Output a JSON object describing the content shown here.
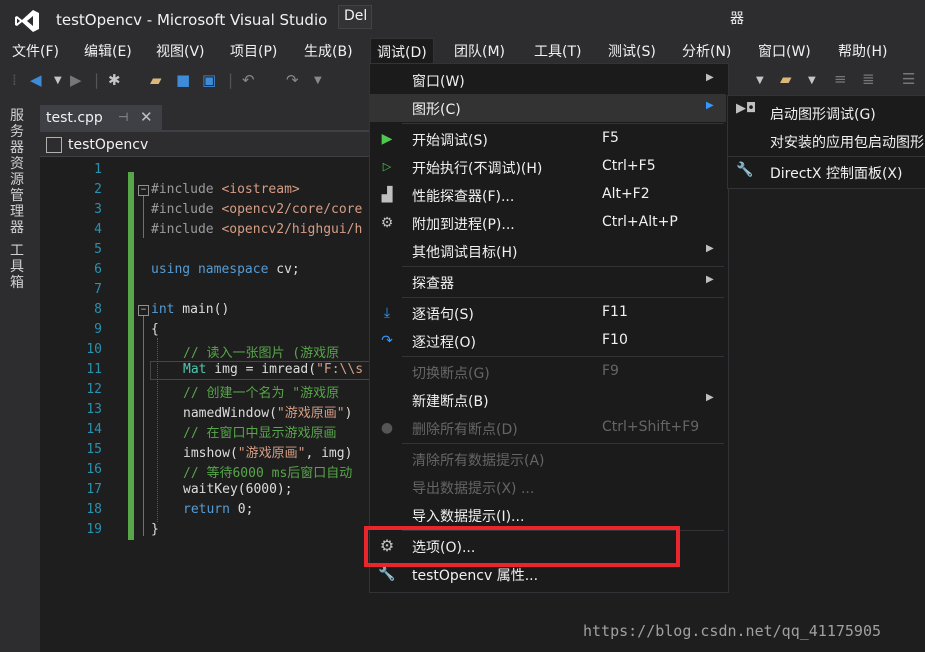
{
  "window": {
    "title": "testOpencv - Microsoft Visual Studio"
  },
  "menubar": [
    {
      "label": "文件(F)"
    },
    {
      "label": "编辑(E)"
    },
    {
      "label": "视图(V)"
    },
    {
      "label": "项目(P)"
    },
    {
      "label": "生成(B)"
    },
    {
      "label": "调试(D)"
    },
    {
      "label": "团队(M)"
    },
    {
      "label": "工具(T)"
    },
    {
      "label": "测试(S)"
    },
    {
      "label": "分析(N)"
    },
    {
      "label": "窗口(W)"
    },
    {
      "label": "帮助(H)"
    }
  ],
  "toolbar": {
    "config_text": "Del",
    "right_text": "器"
  },
  "sidebar": {
    "server_explorer": "服务器资源管理器",
    "toolbox": "工具箱"
  },
  "tab": {
    "name": "test.cpp"
  },
  "navbar": {
    "project": "testOpencv"
  },
  "editor": {
    "line_numbers": [
      "1",
      "2",
      "3",
      "4",
      "5",
      "6",
      "7",
      "8",
      "9",
      "10",
      "11",
      "12",
      "13",
      "14",
      "15",
      "16",
      "17",
      "18",
      "19"
    ],
    "lines": {
      "l2a": "#include ",
      "l2b": "<iostream>",
      "l3a": "#include ",
      "l3b": "<opencv2/core/core",
      "l4a": "#include ",
      "l4b": "<opencv2/highgui/h",
      "l6a": "using",
      "l6b": " namespace",
      "l6c": " cv;",
      "l8a": "int",
      "l8b": " main()",
      "l9": "{",
      "l10": "// 读入一张图片 (游戏原",
      "l11a": "Mat",
      "l11b": " img = imread(",
      "l11c": "\"F:\\\\s",
      "l12": "// 创建一个名为 \"游戏原",
      "l13a": "namedWindow(",
      "l13b": "\"游戏原画\"",
      "l13c": ")",
      "l14": "// 在窗口中显示游戏原画",
      "l15a": "imshow(",
      "l15b": "\"游戏原画\"",
      "l15c": ", img)",
      "l16": "// 等待6000 ms后窗口自动",
      "l17": "waitKey(6000);",
      "l18a": "return",
      "l18b": " 0;",
      "l19": "}"
    }
  },
  "debug_menu": {
    "items": [
      {
        "label": "窗口(W)",
        "shortcut": ""
      },
      {
        "label": "图形(C)",
        "shortcut": ""
      },
      {
        "label": "开始调试(S)",
        "shortcut": "F5"
      },
      {
        "label": "开始执行(不调试)(H)",
        "shortcut": "Ctrl+F5"
      },
      {
        "label": "性能探查器(F)...",
        "shortcut": "Alt+F2"
      },
      {
        "label": "附加到进程(P)...",
        "shortcut": "Ctrl+Alt+P"
      },
      {
        "label": "其他调试目标(H)",
        "shortcut": ""
      },
      {
        "label": "探查器",
        "shortcut": ""
      },
      {
        "label": "逐语句(S)",
        "shortcut": "F11"
      },
      {
        "label": "逐过程(O)",
        "shortcut": "F10"
      },
      {
        "label": "切换断点(G)",
        "shortcut": "F9"
      },
      {
        "label": "新建断点(B)",
        "shortcut": ""
      },
      {
        "label": "删除所有断点(D)",
        "shortcut": "Ctrl+Shift+F9"
      },
      {
        "label": "清除所有数据提示(A)",
        "shortcut": ""
      },
      {
        "label": "导出数据提示(X) ...",
        "shortcut": ""
      },
      {
        "label": "导入数据提示(I)...",
        "shortcut": ""
      },
      {
        "label": "选项(O)...",
        "shortcut": ""
      },
      {
        "label": "testOpencv 属性...",
        "shortcut": ""
      }
    ]
  },
  "graphics_submenu": {
    "items": [
      {
        "label": "启动图形调试(G)"
      },
      {
        "label": "对安装的应用包启动图形"
      },
      {
        "label": "DirectX 控制面板(X)"
      }
    ]
  },
  "watermark": "https://blog.csdn.net/qq_41175905",
  "colors": {
    "accent_green": "#57a64a",
    "highlight_red": "#e8262c",
    "vs_purple": "#68217a",
    "menu_bg": "#1b1b1c"
  }
}
